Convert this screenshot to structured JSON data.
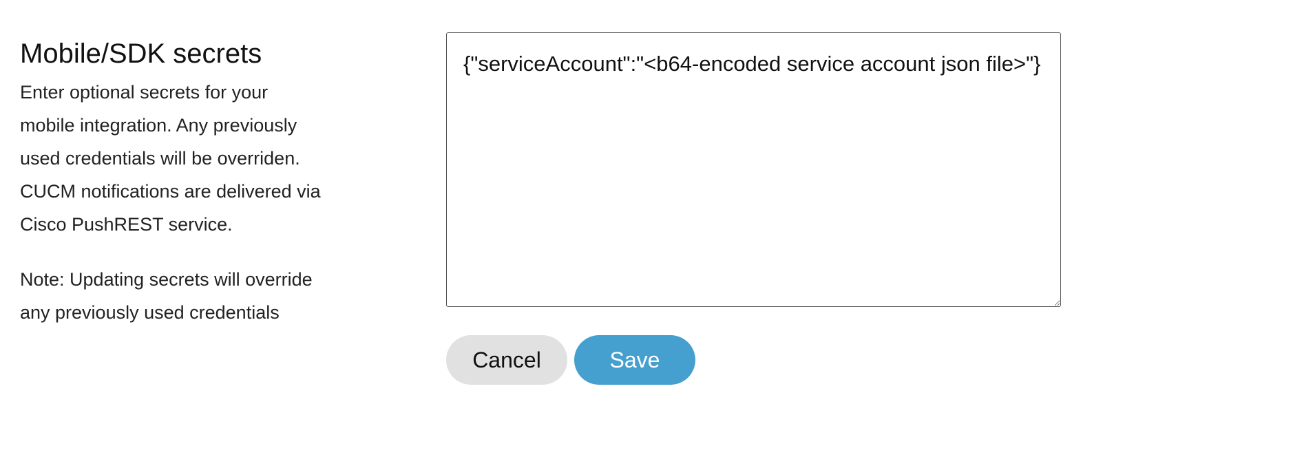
{
  "section": {
    "title": "Mobile/SDK secrets",
    "description": "Enter optional secrets for your mobile integration. Any previously used credentials will be overriden. CUCM notifications are delivered via Cisco PushREST service.",
    "note": "Note: Updating secrets will override any previously used credentials"
  },
  "secrets_field": {
    "value": "{\"serviceAccount\":\"<b64-encoded service account json file>\"}"
  },
  "actions": {
    "cancel_label": "Cancel",
    "save_label": "Save"
  },
  "colors": {
    "save_button": "#459fcf",
    "cancel_button": "#e1e1e1"
  }
}
